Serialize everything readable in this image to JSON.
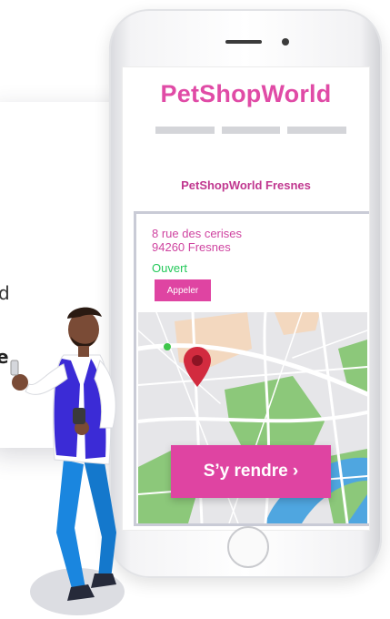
{
  "background": {
    "text_line1": "d",
    "text_line2": "e"
  },
  "app": {
    "brand": "PetShopWorld",
    "nav_items": 3
  },
  "store": {
    "name": "PetShopWorld Fresnes",
    "address_line1": "8 rue des cerises",
    "address_line2": "94260 Fresnes",
    "status": "Ouvert",
    "call_label": "Appeler",
    "directions_label": "S’y rendre ›"
  },
  "colors": {
    "brand": "#e04ba6",
    "accent": "#df44a2",
    "open_status": "#24c95a"
  },
  "icons": [
    "map-pin-icon"
  ]
}
